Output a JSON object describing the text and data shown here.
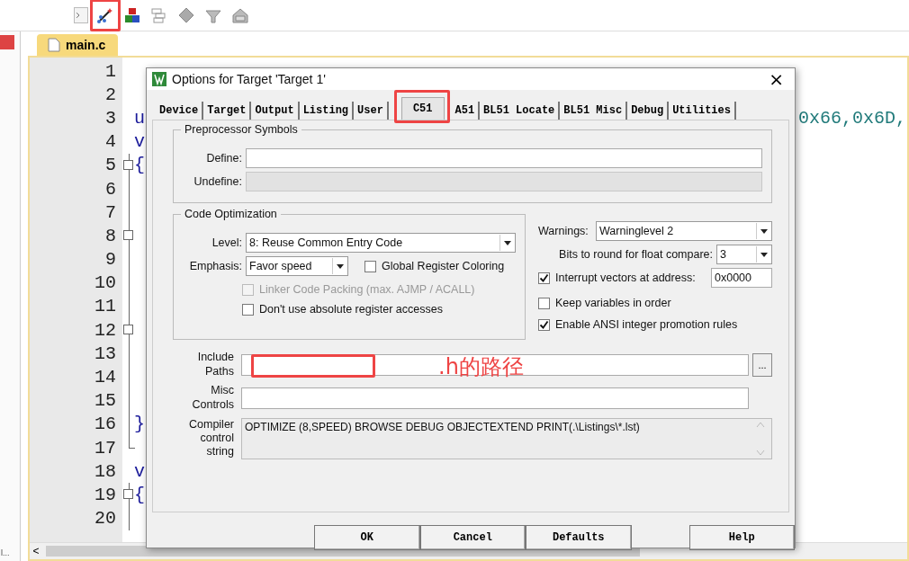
{
  "toolbar": {
    "tools": [
      {
        "highlighted": false
      },
      {
        "highlighted": true
      },
      {
        "highlighted": false
      },
      {
        "highlighted": false
      },
      {
        "highlighted": false
      },
      {
        "highlighted": false
      },
      {
        "highlighted": false
      }
    ]
  },
  "side_panel": {
    "footer": "l..."
  },
  "editor": {
    "tab": "main.c",
    "scroll_left": "<",
    "lines": [
      {
        "number": "1"
      },
      {
        "number": "2"
      },
      {
        "number": "3",
        "left": "u",
        "right": "0x66,0x6D,"
      },
      {
        "number": "4",
        "left": "v"
      },
      {
        "number": "5",
        "left": "{",
        "fold_box": true
      },
      {
        "number": "6",
        "fold_guide": true
      },
      {
        "number": "7",
        "fold_guide": true
      },
      {
        "number": "8",
        "fold_box": true
      },
      {
        "number": "9",
        "fold_guide": true
      },
      {
        "number": "10",
        "fold_guide": true
      },
      {
        "number": "11",
        "fold_guide": true
      },
      {
        "number": "12",
        "fold_box": true
      },
      {
        "number": "13",
        "fold_guide": true
      },
      {
        "number": "14",
        "fold_guide": true
      },
      {
        "number": "15",
        "fold_guide": true
      },
      {
        "number": "16",
        "left": "}",
        "fold_guide": true
      },
      {
        "number": "17",
        "fold_end": true
      },
      {
        "number": "18",
        "left": "v"
      },
      {
        "number": "19",
        "left": "{",
        "fold_box": true
      },
      {
        "number": "20",
        "fold_guide": true
      }
    ]
  },
  "dialog": {
    "title": "Options for Target 'Target 1'",
    "close": "×",
    "tabs": [
      {
        "label": "Device",
        "selected": false
      },
      {
        "label": "Target",
        "selected": false
      },
      {
        "label": "Output",
        "selected": false
      },
      {
        "label": "Listing",
        "selected": false
      },
      {
        "label": "User",
        "selected": false
      },
      {
        "label": "C51",
        "selected": true,
        "highlighted": true
      },
      {
        "label": "A51",
        "selected": false
      },
      {
        "label": "BL51 Locate",
        "selected": false
      },
      {
        "label": "BL51 Misc",
        "selected": false
      },
      {
        "label": "Debug",
        "selected": false
      },
      {
        "label": "Utilities",
        "selected": false
      }
    ],
    "preprocessor": {
      "title": "Preprocessor Symbols",
      "fields": [
        {
          "label": "Define:",
          "disabled": false
        },
        {
          "label": "Undefine:",
          "disabled": true
        }
      ]
    },
    "code_optimization": {
      "title": "Code Optimization",
      "level": {
        "label": "Level:",
        "value": "8: Reuse Common Entry Code"
      },
      "emphasis": {
        "label": "Emphasis:",
        "value": "Favor speed"
      },
      "checkboxes": [
        {
          "label": "Global Register Coloring",
          "checked": false,
          "disabled": false
        },
        {
          "label": "Linker Code Packing (max. AJMP / ACALL)",
          "checked": false,
          "disabled": true
        },
        {
          "label": "Don't use absolute register accesses",
          "checked": false,
          "disabled": false
        }
      ]
    },
    "warnings": {
      "label": "Warnings:",
      "value": "Warninglevel 2"
    },
    "float_bits": {
      "label": "Bits to round for float compare:",
      "value": "3"
    },
    "options": [
      {
        "label": "Interrupt vectors at address:",
        "checked": true,
        "value": "0x0000"
      },
      {
        "label": "Keep variables in order",
        "checked": false
      },
      {
        "label": "Enable ANSI integer promotion rules",
        "checked": true
      }
    ],
    "include_paths": {
      "label": "Include Paths",
      "browse": "...",
      "highlighted": true,
      "note": ".h的路径"
    },
    "misc_controls": {
      "label": "Misc Controls"
    },
    "compiler_string": {
      "label": "Compiler control string",
      "value": "OPTIMIZE (8,SPEED) BROWSE DEBUG OBJECTEXTEND PRINT(.\\Listings\\*.lst)"
    },
    "buttons": [
      "OK",
      "Cancel",
      "Defaults",
      "Help"
    ]
  }
}
